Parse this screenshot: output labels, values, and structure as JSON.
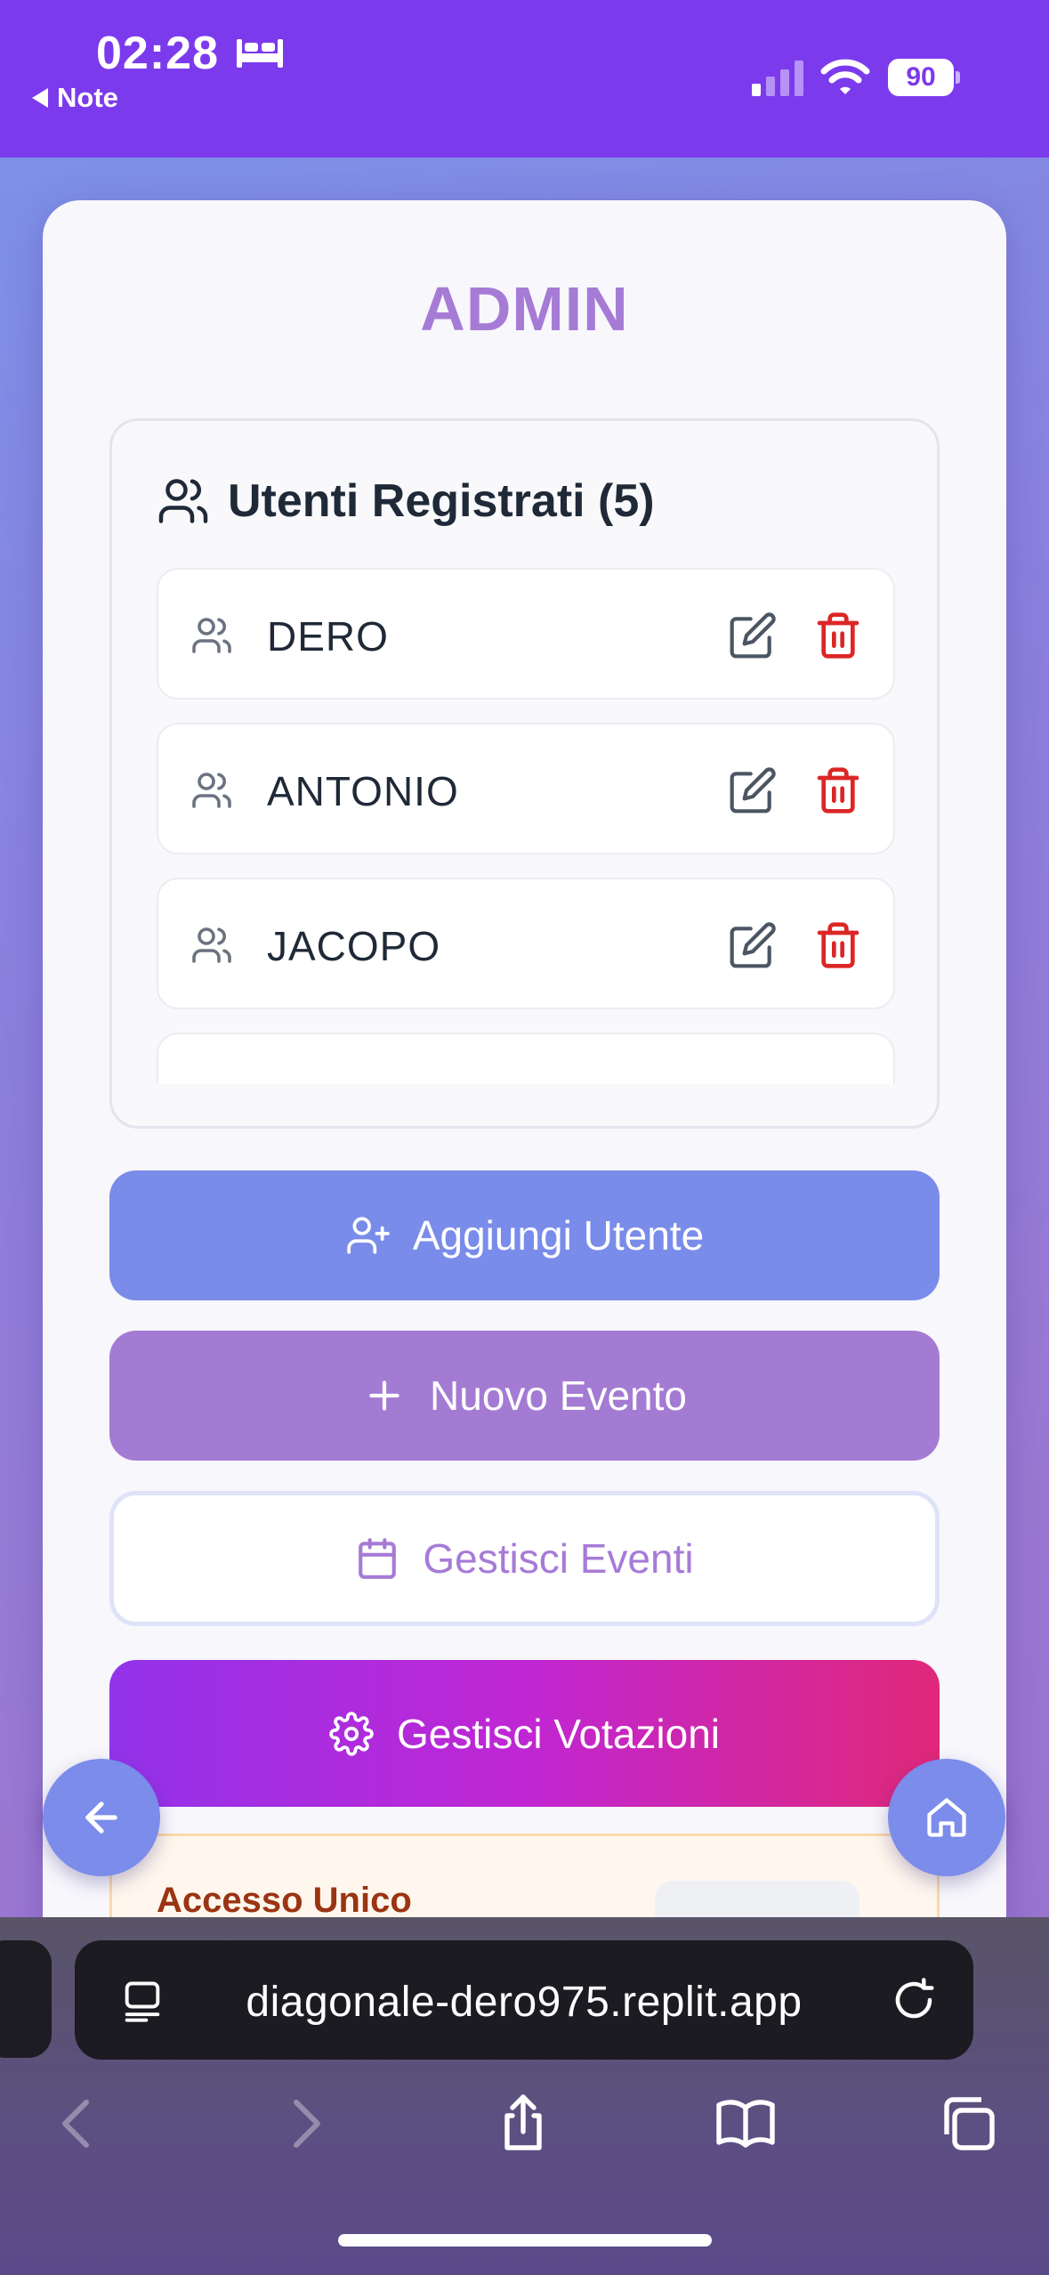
{
  "status_bar": {
    "time": "02:28",
    "back_app": "Note",
    "battery": "90"
  },
  "page": {
    "title": "ADMIN"
  },
  "users_panel": {
    "title": "Utenti Registrati (5)",
    "users": [
      "DERO",
      "ANTONIO",
      "JACOPO"
    ]
  },
  "buttons": {
    "add_user": "Aggiungi Utente",
    "new_event": "Nuovo Evento",
    "manage_events": "Gestisci Eventi",
    "manage_votes": "Gestisci Votazioni"
  },
  "access_panel": {
    "title": "Accesso Unico"
  },
  "browser": {
    "url": "diagonale-dero975.replit.app"
  },
  "colors": {
    "status_bar": "#7c3aed",
    "accent_purple": "#a67bd6",
    "button_blue": "#7a8ce9",
    "button_violet": "#a47bd3",
    "delete_red": "#dc2626"
  }
}
